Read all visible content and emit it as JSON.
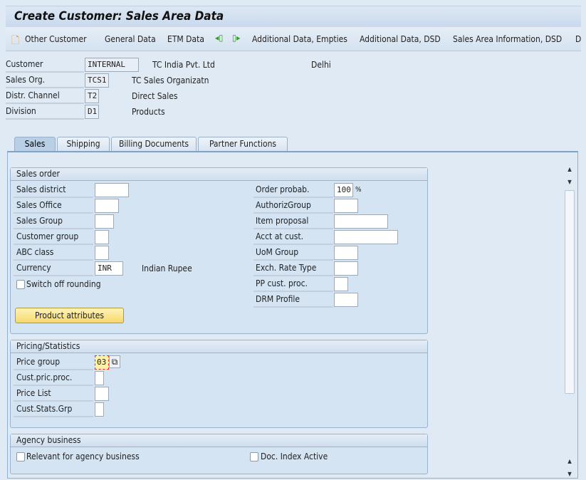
{
  "title": "Create Customer: Sales Area Data",
  "toolbar": {
    "other_customer": "Other Customer",
    "general_data": "General Data",
    "etm_data": "ETM Data",
    "additional_empties": "Additional Data, Empties",
    "additional_dsd": "Additional Data, DSD",
    "sales_area_dsd": "Sales Area Information, DSD",
    "overflow": "D"
  },
  "header": {
    "customer": {
      "label": "Customer",
      "value": "INTERNAL",
      "desc": "TC India Pvt. Ltd",
      "city": "Delhi"
    },
    "sales_org": {
      "label": "Sales Org.",
      "value": "TCS1",
      "desc": "TC Sales Organizatn"
    },
    "distr_channel": {
      "label": "Distr. Channel",
      "value": "T2",
      "desc": "Direct Sales"
    },
    "division": {
      "label": "Division",
      "value": "D1",
      "desc": "Products"
    }
  },
  "tabs": [
    {
      "label": "Sales",
      "active": true
    },
    {
      "label": "Shipping"
    },
    {
      "label": "Billing Documents"
    },
    {
      "label": "Partner Functions"
    }
  ],
  "sales_order": {
    "title": "Sales order",
    "left": [
      {
        "label": "Sales district",
        "value": ""
      },
      {
        "label": "Sales Office",
        "value": ""
      },
      {
        "label": "Sales Group",
        "value": ""
      },
      {
        "label": "Customer group",
        "value": ""
      },
      {
        "label": "ABC class",
        "value": ""
      },
      {
        "label": "Currency",
        "value": "INR",
        "desc": "Indian Rupee"
      }
    ],
    "switch_off_rounding": {
      "label": "Switch off rounding",
      "checked": false
    },
    "right": [
      {
        "label": "Order probab.",
        "value": "100",
        "unit": "%"
      },
      {
        "label": "AuthorizGroup",
        "value": ""
      },
      {
        "label": "Item proposal",
        "value": ""
      },
      {
        "label": "Acct at cust.",
        "value": ""
      },
      {
        "label": "UoM Group",
        "value": ""
      },
      {
        "label": "Exch. Rate Type",
        "value": ""
      },
      {
        "label": "PP cust. proc.",
        "value": ""
      },
      {
        "label": "DRM Profile",
        "value": ""
      }
    ],
    "product_attributes": "Product attributes"
  },
  "pricing": {
    "title": "Pricing/Statistics",
    "rows": [
      {
        "label": "Price group",
        "value": "03"
      },
      {
        "label": "Cust.pric.proc.",
        "value": ""
      },
      {
        "label": "Price List",
        "value": ""
      },
      {
        "label": "Cust.Stats.Grp",
        "value": ""
      }
    ]
  },
  "agency": {
    "title": "Agency business",
    "relevant": {
      "label": "Relevant for agency business",
      "checked": false
    },
    "doc_index": {
      "label": "Doc. Index Active",
      "checked": false
    }
  }
}
